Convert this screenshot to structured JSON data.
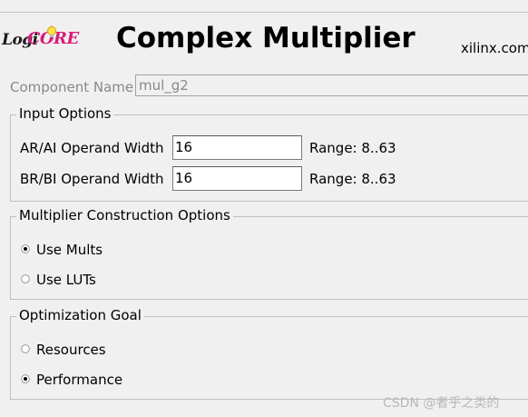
{
  "header": {
    "logo_text_a": "Logi",
    "logo_text_b": "CORE",
    "title": "Complex Multiplier",
    "brand": "xilinx.com"
  },
  "component": {
    "label": "Component Name",
    "value": "mul_g2"
  },
  "input_options": {
    "title": "Input Options",
    "ar_ai_label": "AR/AI Operand Width",
    "ar_ai_value": "16",
    "ar_ai_range": "Range: 8..63",
    "br_bi_label": "BR/BI Operand Width",
    "br_bi_value": "16",
    "br_bi_range": "Range: 8..63"
  },
  "construction": {
    "title": "Multiplier Construction Options",
    "opt_mults": "Use Mults",
    "opt_luts": "Use LUTs",
    "selected": "Use Mults"
  },
  "optimization": {
    "title": "Optimization Goal",
    "opt_resources": "Resources",
    "opt_performance": "Performance",
    "selected": "Performance"
  },
  "watermark": "CSDN @者乎之类的",
  "colors": {
    "background": "#f0f0f0",
    "logo_accent": "#d81b7a",
    "disabled_text": "#888888"
  }
}
